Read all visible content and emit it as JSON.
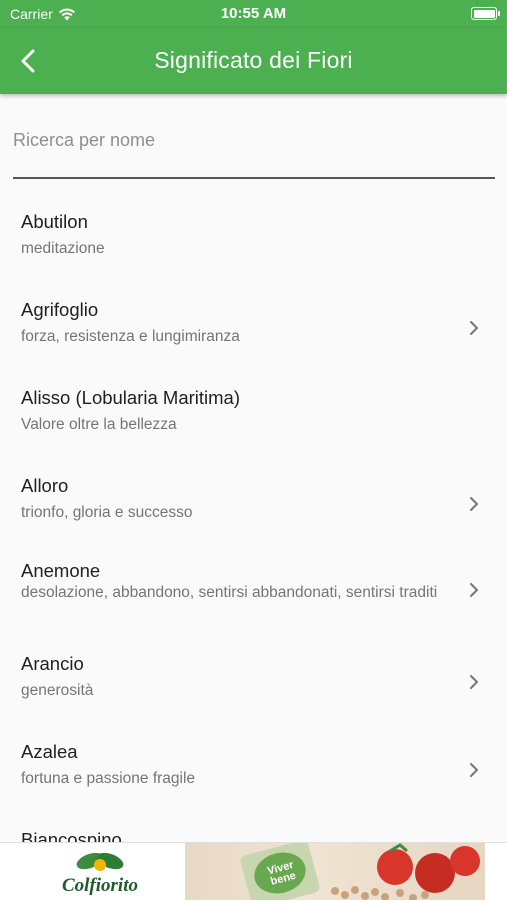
{
  "status_bar": {
    "carrier": "Carrier",
    "time": "10:55 AM",
    "battery_level": 1.0
  },
  "header": {
    "title": "Significato dei Fiori",
    "back_icon": "chevron-left-icon",
    "background_color": "#4caf50"
  },
  "search": {
    "placeholder": "Ricerca per nome",
    "value": ""
  },
  "flowers": [
    {
      "name": "Abutilon",
      "meaning": "meditazione",
      "has_chevron": false
    },
    {
      "name": "Agrifoglio",
      "meaning": "forza, resistenza e lungimiranza",
      "has_chevron": true
    },
    {
      "name": "Alisso (Lobularia Maritima)",
      "meaning": "Valore oltre la bellezza",
      "has_chevron": false
    },
    {
      "name": "Alloro",
      "meaning": "trionfo, gloria e successo",
      "has_chevron": true
    },
    {
      "name": "Anemone",
      "meaning": "desolazione, abbandono, sentirsi abbandonati, sentirsi traditi",
      "has_chevron": true
    },
    {
      "name": "Arancio",
      "meaning": "generosità",
      "has_chevron": true
    },
    {
      "name": "Azalea",
      "meaning": "fortuna e passione fragile",
      "has_chevron": true
    },
    {
      "name": "Biancospino",
      "meaning": "",
      "has_chevron": true
    }
  ],
  "ad": {
    "brand": "Colfiorito",
    "product_text": "Viver bene"
  }
}
